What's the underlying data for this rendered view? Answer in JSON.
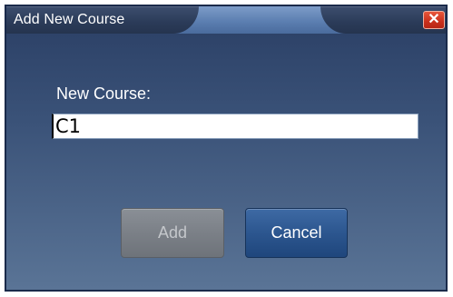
{
  "window": {
    "title": "Add New Course",
    "close_glyph": "✕"
  },
  "form": {
    "label": "New Course:",
    "course_value": "C1"
  },
  "buttons": {
    "add_label": "Add",
    "add_enabled": false,
    "cancel_label": "Cancel"
  },
  "colors": {
    "dialog_background": "#3a5278",
    "close_button": "#c9301c",
    "cancel_button": "#2c568f",
    "add_button_disabled": "#7b8087"
  }
}
